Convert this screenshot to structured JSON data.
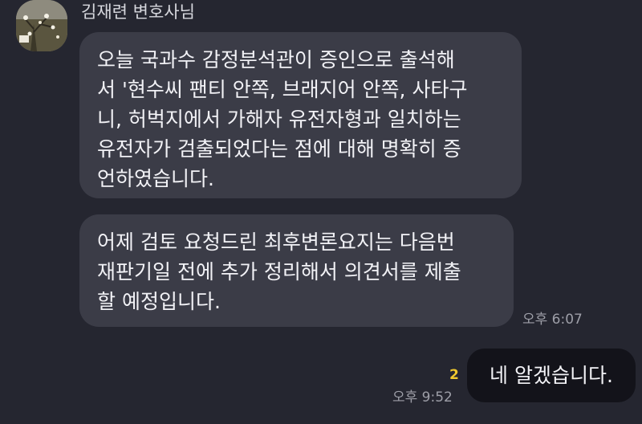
{
  "conversation": {
    "sender_name": "김재련 변호사님",
    "incoming": [
      {
        "lines": [
          "오늘 국과수 감정분석관이 증인으로 출석해",
          "서 '현수씨 팬티 안쪽, 브래지어 안쪽, 사타구",
          "니, 허벅지에서 가해자 유전자형과 일치하는",
          "유전자가 검출되었다는 점에 대해 명확히 증",
          "언하였습니다."
        ]
      },
      {
        "lines": [
          "어제 검토 요청드린 최후변론요지는 다음번",
          "재판기일 전에 추가 정리해서 의견서를 제출",
          "할 예정입니다."
        ],
        "time": "오후 6:07"
      }
    ],
    "outgoing": {
      "text": "네 알겠습니다.",
      "unread_count": "2",
      "time": "오후 9:52"
    }
  },
  "colors": {
    "background": "#252630",
    "incoming_bubble": "#3b3c47",
    "outgoing_bubble": "#13131a",
    "unread_badge": "#f0c92e"
  },
  "icons": {
    "avatar": "profile-photo"
  }
}
